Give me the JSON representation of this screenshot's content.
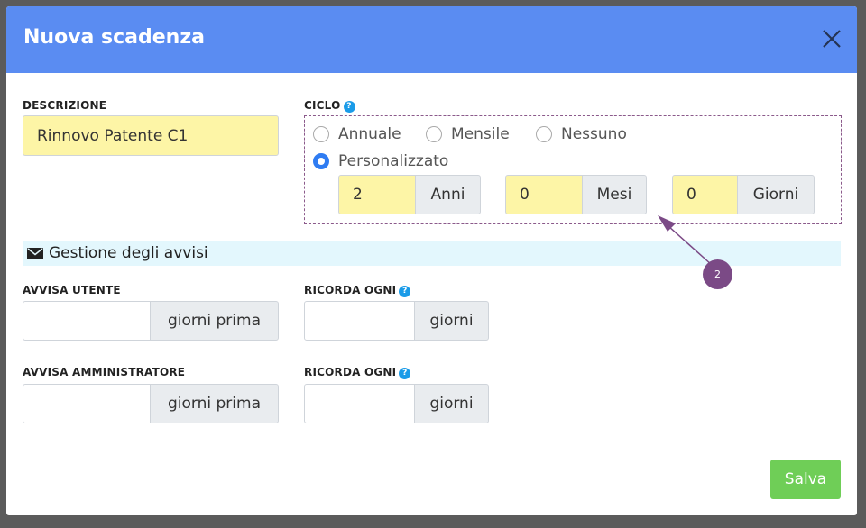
{
  "dialog": {
    "title": "Nuova scadenza",
    "close_icon": "close-icon"
  },
  "descrizione": {
    "label": "DESCRIZIONE",
    "value": "Rinnovo Patente C1"
  },
  "ciclo": {
    "label": "CICLO",
    "help": "?",
    "options": [
      {
        "label": "Annuale",
        "selected": false
      },
      {
        "label": "Mensile",
        "selected": false
      },
      {
        "label": "Nessuno",
        "selected": false
      },
      {
        "label": "Personalizzato",
        "selected": true
      }
    ],
    "anni": {
      "value": "2",
      "unit": "Anni"
    },
    "mesi": {
      "value": "0",
      "unit": "Mesi"
    },
    "giorni": {
      "value": "0",
      "unit": "Giorni"
    }
  },
  "avvisi": {
    "section_title": "Gestione degli avvisi",
    "section_icon": "envelope-icon",
    "utente": {
      "label": "AVVISA UTENTE",
      "value": "",
      "unit": "giorni prima"
    },
    "utente_ricorda": {
      "label": "RICORDA OGNI",
      "help": "?",
      "value": "",
      "unit": "giorni"
    },
    "admin": {
      "label": "AVVISA AMMINISTRATORE",
      "value": "",
      "unit": "giorni prima"
    },
    "admin_ricorda": {
      "label": "RICORDA OGNI",
      "help": "?",
      "value": "",
      "unit": "giorni"
    }
  },
  "footer": {
    "save_label": "Salva"
  },
  "annotation": {
    "callout_number": "2"
  },
  "colors": {
    "header": "#5a8cf2",
    "input_highlight": "#fdf5a6",
    "section_bg": "#e3f7fd",
    "save": "#6fce57",
    "callout": "#7b4a86",
    "radio_selected": "#2f7cf2"
  }
}
